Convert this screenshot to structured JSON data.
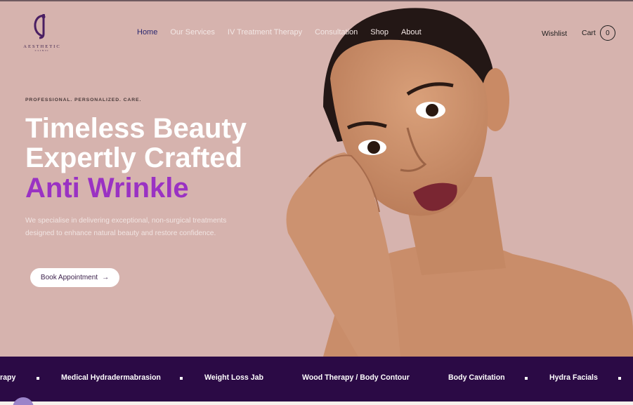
{
  "brand": {
    "name": "AESTHETIC",
    "subtitle": "CLINIC",
    "colors": {
      "primary": "#2b0a45",
      "accent": "#9a32c3",
      "hero_bg": "#d6b3ae"
    }
  },
  "nav": {
    "items": [
      {
        "label": "Home",
        "active": true
      },
      {
        "label": "Our Services",
        "active": false
      },
      {
        "label": "IV Treatment Therapy",
        "active": false
      },
      {
        "label": "Consultation",
        "active": false
      },
      {
        "label": "Shop",
        "active": false
      },
      {
        "label": "About",
        "active": false
      }
    ],
    "wishlist": "Wishlist",
    "cart_label": "Cart",
    "cart_count": "0"
  },
  "hero": {
    "eyebrow": "PROFESSIONAL. PERSONALIZED. CARE.",
    "title_line1": "Timeless Beauty",
    "title_line2": "Expertly Crafted",
    "title_highlight": "Anti Wrinkle",
    "description": "We specialise in delivering exceptional, non-surgical treatments designed to enhance natural beauty and restore confidence.",
    "cta": "Book Appointment",
    "cta_icon": "arrow-right-icon"
  },
  "ticker": {
    "items": [
      "rapy",
      "Medical Hydradermabrasion",
      "Weight Loss Jab",
      "Wood Therapy / Body Contour",
      "Body Cavitation",
      "Hydra Facials"
    ]
  }
}
